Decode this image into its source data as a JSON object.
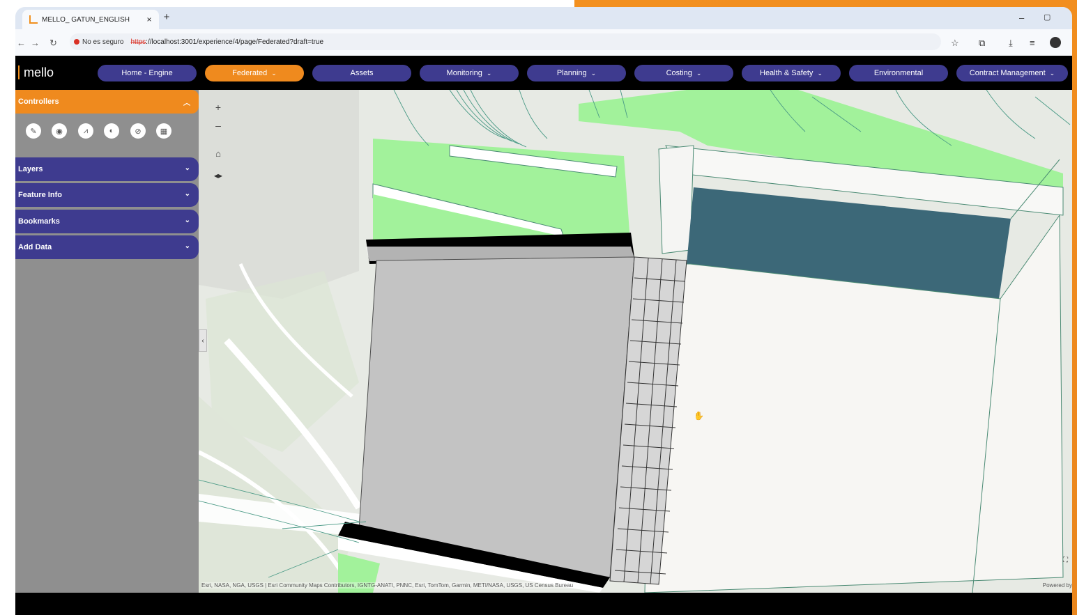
{
  "browser": {
    "tab_title": "MELLO_ GATUN_ENGLISH",
    "tab_close": "×",
    "new_tab": "+",
    "minimize": "–",
    "restore": "▢",
    "security_label": "No es seguro",
    "url_scheme": "https",
    "url_rest": "://localhost:3001/experience/4/page/Federated?draft=true",
    "icons": [
      "back-icon",
      "forward-icon",
      "reload-icon",
      "star-icon",
      "extensions-icon",
      "download-icon",
      "reading-list-icon",
      "profile-icon"
    ]
  },
  "app": {
    "logo_text": "mello",
    "nav": [
      {
        "label": "Home - Engine",
        "chevron": false,
        "active": false
      },
      {
        "label": "Federated",
        "chevron": true,
        "active": true
      },
      {
        "label": "Assets",
        "chevron": false,
        "active": false
      },
      {
        "label": "Monitoring",
        "chevron": true,
        "active": false
      },
      {
        "label": "Planning",
        "chevron": true,
        "active": false
      },
      {
        "label": "Costing",
        "chevron": true,
        "active": false
      },
      {
        "label": "Health & Safety",
        "chevron": true,
        "active": false
      },
      {
        "label": "Environmental",
        "chevron": false,
        "active": false
      },
      {
        "label": "Contract Management",
        "chevron": true,
        "active": false
      }
    ],
    "colors": {
      "accent_orange": "#ef8a1e",
      "nav_purple": "#3e3b8f",
      "sidebar_gray": "#8f8f8f",
      "appbar": "#000000"
    }
  },
  "sidebar": {
    "controllers_label": "Controllers",
    "tools": [
      "measure-icon",
      "location-pin-icon",
      "chart-icon",
      "split-icon",
      "view-hide-icon",
      "grid-icon"
    ],
    "accordions": [
      "Layers",
      "Feature Info",
      "Bookmarks",
      "Add Data"
    ]
  },
  "map": {
    "zoom_in": "+",
    "zoom_out": "–",
    "home": "⌂",
    "compass": "◂▸",
    "attribution": "Esri, NASA, NGA, USGS | Esri Community Maps Contributors, IGNTG-ANATI, PNNC, Esri, TomTom, Garmin, METI/NASA, USGS, US Census Bureau",
    "powered_by": "Powered by",
    "collapse": "‹",
    "fullscreen": "⛶",
    "cursor": "✋"
  }
}
